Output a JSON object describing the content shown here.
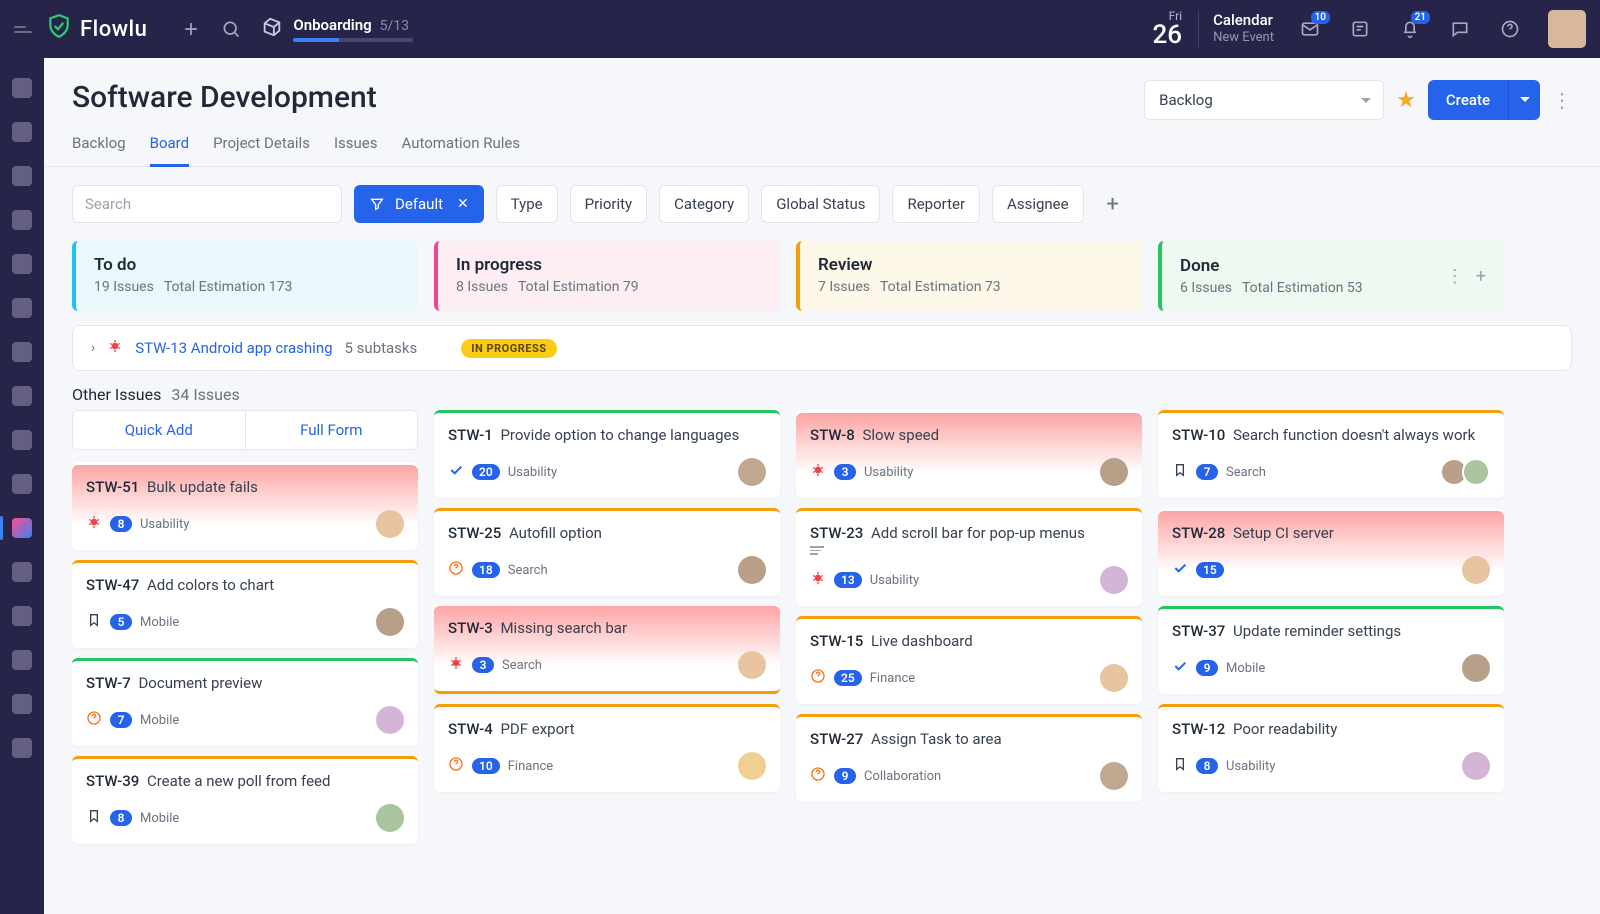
{
  "brand": "Flowlu",
  "onboarding": {
    "label": "Onboarding",
    "progress": "5/13"
  },
  "date": {
    "day": "Fri",
    "num": "26"
  },
  "calendar": {
    "title": "Calendar",
    "new": "New Event"
  },
  "badges": {
    "inbox": "10",
    "bell": "21"
  },
  "page": {
    "title": "Software Development"
  },
  "viewSelect": "Backlog",
  "createLabel": "Create",
  "tabs": [
    "Backlog",
    "Board",
    "Project Details",
    "Issues",
    "Automation Rules"
  ],
  "activeTab": 1,
  "searchPlaceholder": "Search",
  "filterDefault": "Default",
  "filterChips": [
    "Type",
    "Priority",
    "Category",
    "Global Status",
    "Reporter",
    "Assignee"
  ],
  "columns": {
    "todo": {
      "title": "To do",
      "issues": "19 Issues",
      "est": "Total Estimation 173"
    },
    "progress": {
      "title": "In progress",
      "issues": "8 Issues",
      "est": "Total Estimation 79"
    },
    "review": {
      "title": "Review",
      "issues": "7 Issues",
      "est": "Total Estimation 73"
    },
    "done": {
      "title": "Done",
      "issues": "6 Issues",
      "est": "Total Estimation 53"
    }
  },
  "swim": {
    "key": "STW-13",
    "title": "Android app crashing",
    "subtasks": "5 subtasks",
    "status": "IN PROGRESS"
  },
  "other": {
    "title": "Other Issues",
    "count": "34 Issues"
  },
  "quickAdd": {
    "quick": "Quick Add",
    "full": "Full Form"
  },
  "todoCards": [
    {
      "key": "STW-51",
      "title": "Bulk update fails",
      "icon": "bug",
      "pill": "8",
      "cat": "Usability",
      "top": "red",
      "a": "a1"
    },
    {
      "key": "STW-47",
      "title": "Add colors to chart",
      "icon": "bm",
      "pill": "5",
      "cat": "Mobile",
      "top": "yellow",
      "a": "a2"
    },
    {
      "key": "STW-7",
      "title": "Document preview",
      "icon": "q",
      "pill": "7",
      "cat": "Mobile",
      "top": "green",
      "a": "a3"
    },
    {
      "key": "STW-39",
      "title": "Create a new poll from feed",
      "icon": "bm",
      "pill": "8",
      "cat": "Mobile",
      "top": "yellow",
      "a": "a4"
    }
  ],
  "progCards": [
    {
      "key": "STW-1",
      "title": "Provide option to change languages",
      "icon": "check",
      "pill": "20",
      "cat": "Usability",
      "top": "green",
      "a": "a5"
    },
    {
      "key": "STW-25",
      "title": "Autofill option",
      "icon": "q",
      "pill": "18",
      "cat": "Search",
      "top": "yellow",
      "a": "a2"
    },
    {
      "key": "STW-3",
      "title": "Missing search bar",
      "icon": "bug",
      "pill": "3",
      "cat": "Search",
      "top": "red-yb",
      "a": "a1"
    },
    {
      "key": "STW-4",
      "title": "PDF export",
      "icon": "q",
      "pill": "10",
      "cat": "Finance",
      "top": "yellow",
      "a": "a6"
    }
  ],
  "revCards": [
    {
      "key": "STW-8",
      "title": "Slow speed",
      "icon": "bug",
      "pill": "3",
      "cat": "Usability",
      "top": "red",
      "a": "a2"
    },
    {
      "key": "STW-23",
      "title": "Add scroll bar for pop-up menus",
      "icon": "bug",
      "pill": "13",
      "cat": "Usability",
      "top": "yellow",
      "a": "a3",
      "desc": true
    },
    {
      "key": "STW-15",
      "title": "Live dashboard",
      "icon": "q",
      "pill": "25",
      "cat": "Finance",
      "top": "yellow",
      "a": "a1"
    },
    {
      "key": "STW-27",
      "title": "Assign Task to area",
      "icon": "q",
      "pill": "9",
      "cat": "Collaboration",
      "top": "yellow",
      "a": "a5"
    }
  ],
  "doneCards": [
    {
      "key": "STW-10",
      "title": "Search function doesn't always work",
      "icon": "bm",
      "pill": "7",
      "cat": "Search",
      "top": "yellow",
      "stack": true
    },
    {
      "key": "STW-28",
      "title": "Setup CI server",
      "icon": "check",
      "pill": "15",
      "cat": "",
      "top": "red",
      "a": "a1"
    },
    {
      "key": "STW-37",
      "title": "Update reminder settings",
      "icon": "check",
      "pill": "9",
      "cat": "Mobile",
      "top": "green",
      "a": "a2"
    },
    {
      "key": "STW-12",
      "title": "Poor readability",
      "icon": "bm",
      "pill": "8",
      "cat": "Usability",
      "top": "yellow",
      "a": "a3"
    }
  ]
}
